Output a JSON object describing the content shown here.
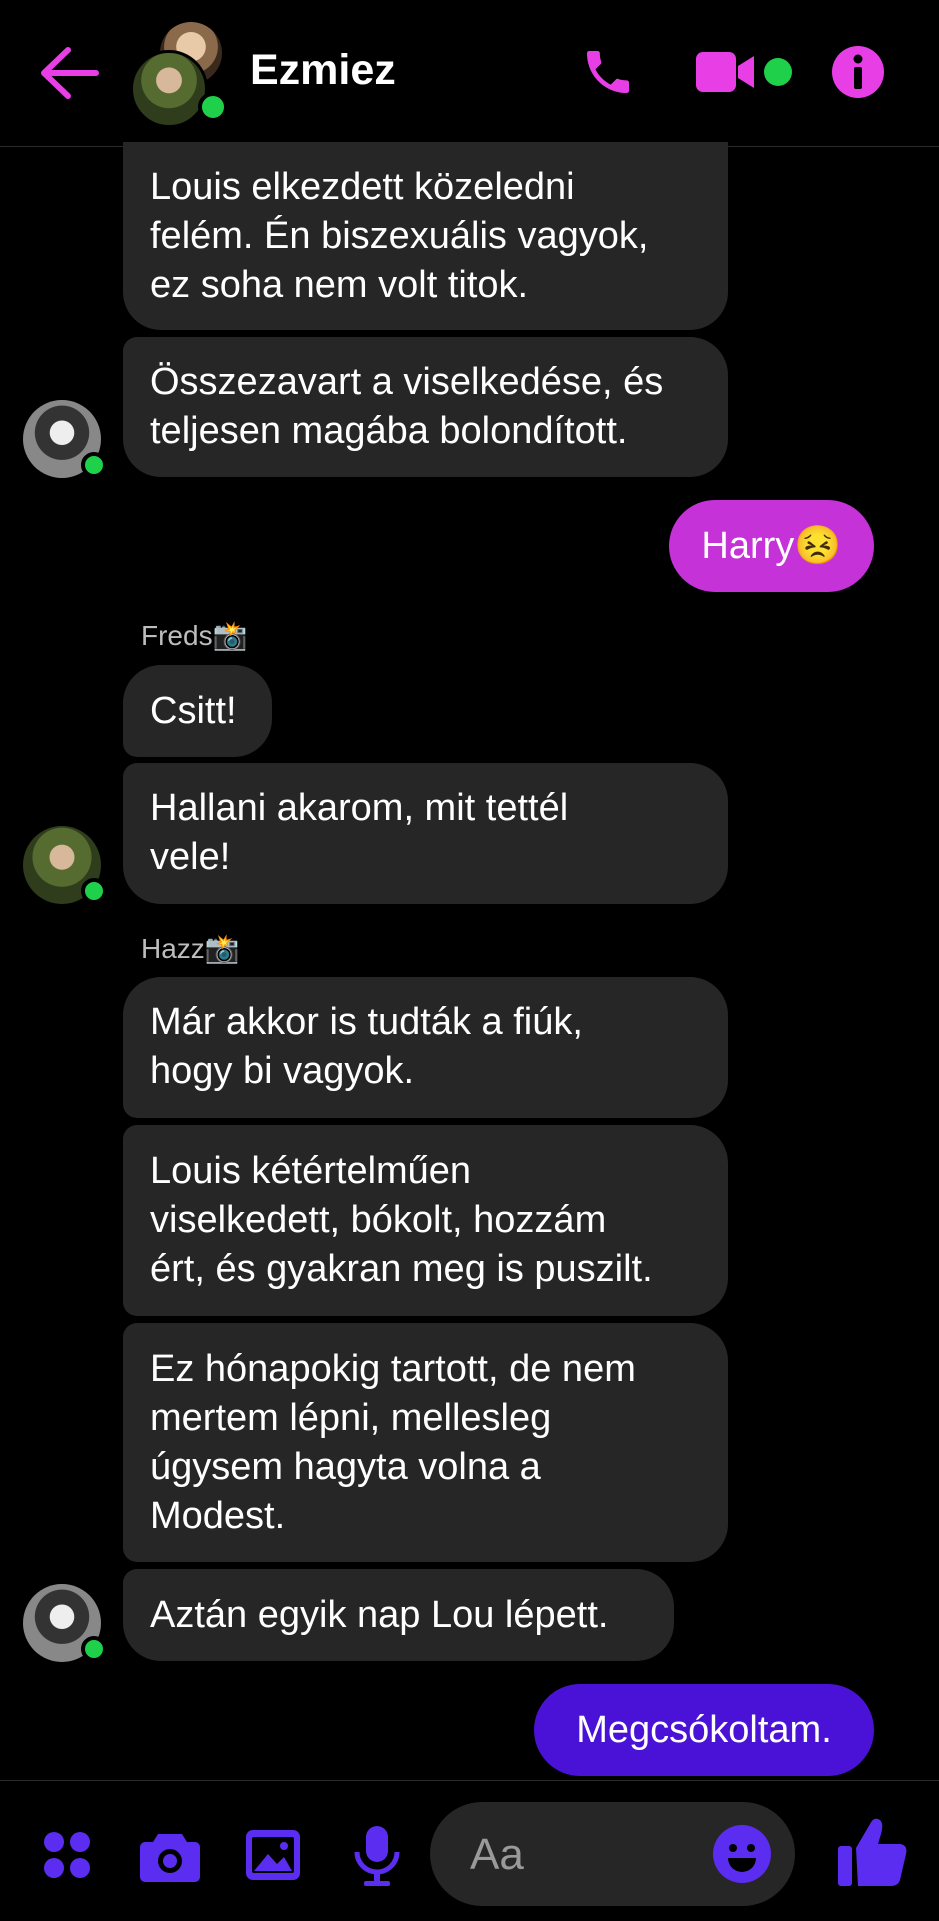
{
  "header": {
    "title": "Ezmiez",
    "icons": [
      "back-arrow-icon",
      "phone-icon",
      "video-camera-icon",
      "info-icon"
    ]
  },
  "colors": {
    "accent": "#e83ee6",
    "outgoing_magenta": "#c432d8",
    "outgoing_purple": "#4a12d6",
    "incoming_bubble": "#262626",
    "online": "#1fd04b",
    "toolbar_purple": "#5b2df0"
  },
  "messages": [
    {
      "lines": [
        "Louis elkezdett közeledni",
        "felém. Én biszexuális vagyok,",
        "ez soha nem volt titok."
      ]
    },
    {
      "lines": [
        "Összezavart a viselkedése, és",
        "teljesen magába bolondított."
      ]
    },
    {
      "text": "Harry😣"
    },
    {
      "sender": "Freds📸",
      "text": "Csitt!"
    },
    {
      "lines": [
        "Hallani akarom, mit tettél",
        "vele!"
      ]
    },
    {
      "sender": "Hazz📸",
      "lines": [
        "Már akkor is tudták a fiúk,",
        "hogy bi vagyok."
      ]
    },
    {
      "lines": [
        "Louis kétértelműen",
        "viselkedett, bókolt, hozzám",
        "ért, és gyakran meg is puszilt."
      ]
    },
    {
      "lines": [
        "Ez hónapokig tartott, de nem",
        "mertem lépni, mellesleg",
        "úgysem hagyta volna a",
        "Modest."
      ]
    },
    {
      "text": "Aztán egyik nap Lou lépett."
    },
    {
      "text": "Megcsókoltam."
    }
  ],
  "composer": {
    "placeholder": "Aa",
    "icons": [
      "apps-icon",
      "camera-icon",
      "gallery-icon",
      "microphone-icon",
      "emoji-icon",
      "thumbs-up-icon"
    ]
  }
}
